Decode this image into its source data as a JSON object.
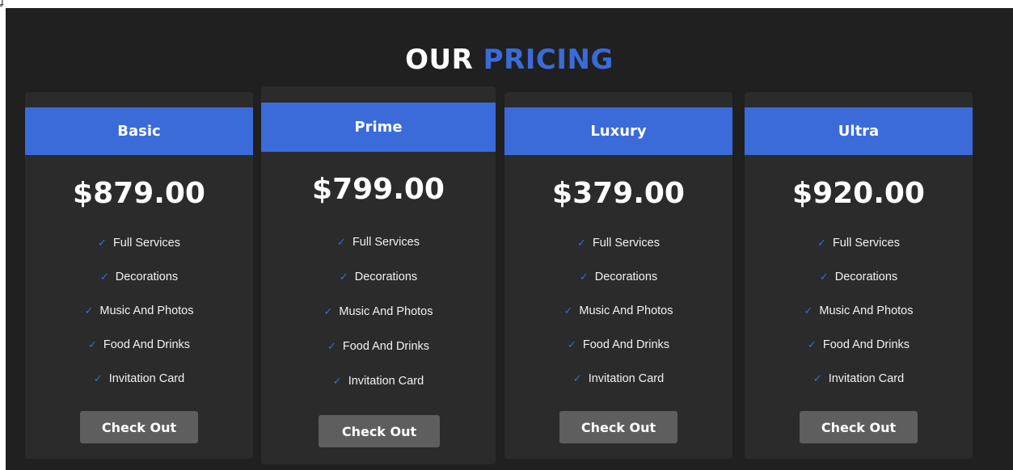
{
  "corner_mark": "ʝ",
  "heading": {
    "first": "OUR",
    "second": "PRICING",
    "accent_color": "#3a6bd9"
  },
  "plans": [
    {
      "name": "Basic",
      "price": "$879.00",
      "features": [
        "Full Services",
        "Decorations",
        "Music And Photos",
        "Food And Drinks",
        "Invitation Card"
      ],
      "button": "Check Out"
    },
    {
      "name": "Prime",
      "price": "$799.00",
      "features": [
        "Full Services",
        "Decorations",
        "Music And Photos",
        "Food And Drinks",
        "Invitation Card"
      ],
      "button": "Check Out"
    },
    {
      "name": "Luxury",
      "price": "$379.00",
      "features": [
        "Full Services",
        "Decorations",
        "Music And Photos",
        "Food And Drinks",
        "Invitation Card"
      ],
      "button": "Check Out"
    },
    {
      "name": "Ultra",
      "price": "$920.00",
      "features": [
        "Full Services",
        "Decorations",
        "Music And Photos",
        "Food And Drinks",
        "Invitation Card"
      ],
      "button": "Check Out"
    }
  ],
  "icons": {
    "feature_bullet": "check-icon",
    "check_glyph": "✓"
  },
  "colors": {
    "background": "#202020",
    "card": "#2b2b2b",
    "accent": "#3a6bd9",
    "button": "#5e5e5e"
  }
}
